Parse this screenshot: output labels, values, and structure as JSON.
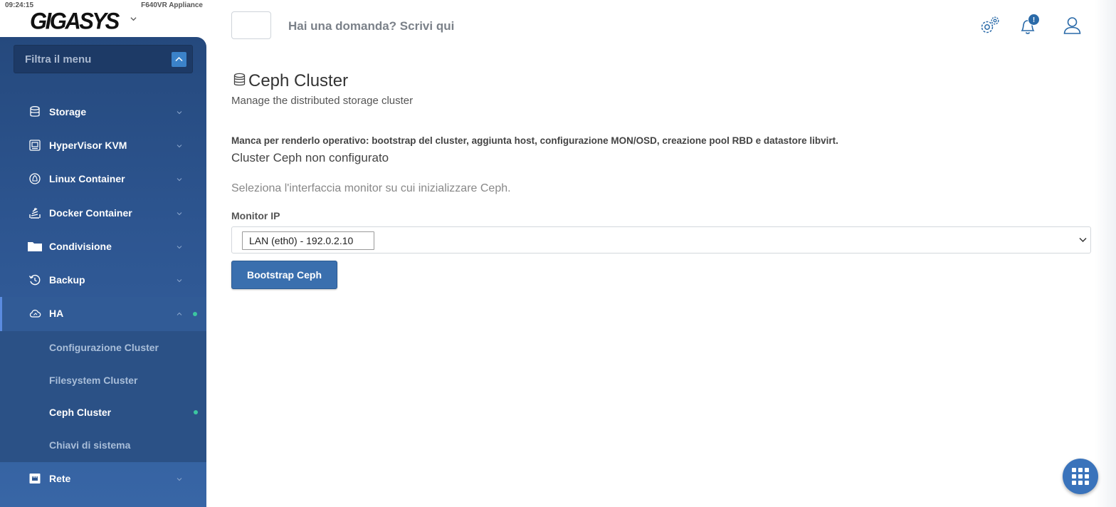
{
  "status_bar": {
    "time": "09:24:15",
    "appliance": "F640VR Appliance"
  },
  "brand": {
    "logo_text": "GIGASYS"
  },
  "sidebar": {
    "filter_placeholder": "Filtra il menu",
    "items": [
      {
        "label": "Storage",
        "icon": "database-icon"
      },
      {
        "label": "HyperVisor KVM",
        "icon": "server-icon"
      },
      {
        "label": "Linux Container",
        "icon": "linux-icon"
      },
      {
        "label": "Docker Container",
        "icon": "stack-icon"
      },
      {
        "label": "Condivisione",
        "icon": "folder-icon"
      },
      {
        "label": "Backup",
        "icon": "backup-icon"
      },
      {
        "label": "HA",
        "icon": "cloud-icon"
      },
      {
        "label": "Rete",
        "icon": "network-icon"
      }
    ],
    "ha_submenu": [
      {
        "label": "Configurazione Cluster"
      },
      {
        "label": "Filesystem Cluster"
      },
      {
        "label": "Ceph Cluster"
      },
      {
        "label": "Chiavi di sistema"
      }
    ]
  },
  "header": {
    "question": "Hai una domanda? Scrivi qui",
    "notification_badge": "!",
    "icons": [
      "settings-icon",
      "bell-icon",
      "user-icon"
    ]
  },
  "main": {
    "title": "Ceph Cluster",
    "subtitle": "Manage the distributed storage cluster",
    "warning": "Manca per renderlo operativo: bootstrap del cluster, aggiunta host, configurazione MON/OSD, creazione pool RBD e datastore libvirt.",
    "status": "Cluster Ceph non configurato",
    "hint": "Seleziona l'interfaccia monitor su cui inizializzare Ceph.",
    "monitor_label": "Monitor IP",
    "monitor_selected": "LAN (eth0) - 192.0.2.10",
    "bootstrap_button": "Bootstrap Ceph"
  },
  "colors": {
    "sidebar": "#2d5590",
    "primary": "#3a6fae",
    "active_dot": "#3cc6a0"
  }
}
